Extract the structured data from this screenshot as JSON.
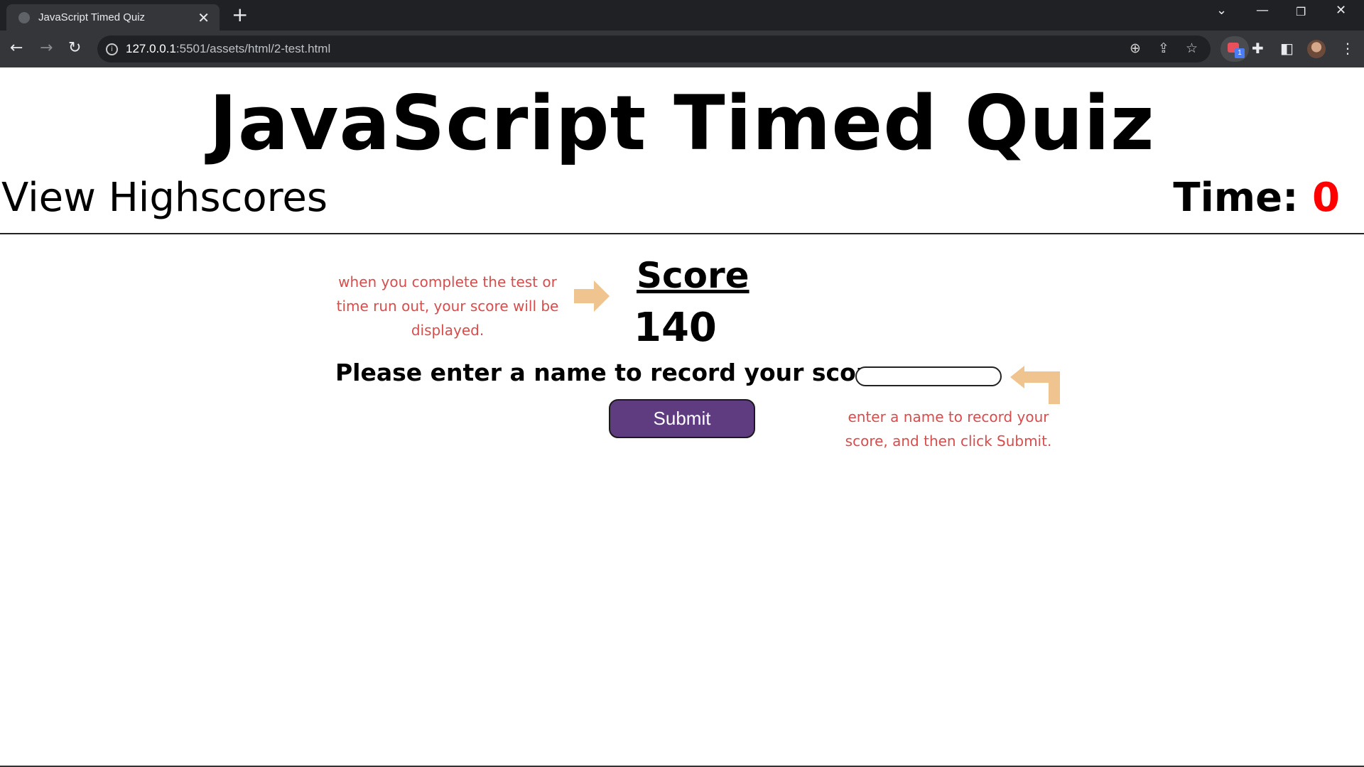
{
  "browser": {
    "tab": {
      "title": "JavaScript Timed Quiz",
      "close_icon": "close-icon",
      "favicon": "globe-icon"
    },
    "new_tab_icon": "plus-icon",
    "window_controls": [
      "chevron-down-icon",
      "minimize-icon",
      "restore-icon",
      "close-icon"
    ],
    "nav": [
      "back-icon",
      "forward-icon",
      "reload-icon"
    ],
    "url": {
      "host": "127.0.0.1",
      "path": ":5501/assets/html/2-test.html"
    },
    "omnibox_icons": [
      "zoom-icon",
      "share-icon",
      "star-icon"
    ],
    "extension_badge_count": "1",
    "toolbar_icons": [
      "extensions-puzzle-icon",
      "side-panel-icon",
      "profile-avatar",
      "menu-kebab-icon"
    ]
  },
  "page": {
    "title": "JavaScript Timed Quiz",
    "view_highscores": "View Highscores",
    "timer_label": "Time:",
    "timer_value": "0",
    "score_heading": "Score",
    "score_value": "140",
    "name_prompt": "Please enter a name to record your score:",
    "name_input_value": "",
    "submit_label": "Submit",
    "note_left": "when you complete the test or time run out, your score will be displayed.",
    "note_right": "enter a name to record your score, and then click Submit."
  },
  "colors": {
    "accent_button": "#5f3b80",
    "timer_value": "#ff0000",
    "annotation_text": "#d94c4c",
    "annotation_arrow": "#f0c48e"
  }
}
